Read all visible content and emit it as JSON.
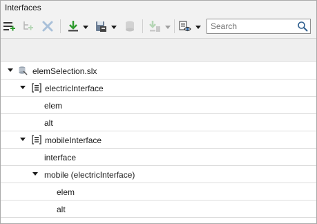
{
  "panel": {
    "title": "Interfaces"
  },
  "toolbar": {
    "buttons": [
      {
        "icon": "add-interface-icon"
      },
      {
        "icon": "add-element-icon"
      },
      {
        "icon": "delete-icon"
      },
      {
        "icon": "import-icon"
      },
      {
        "icon": "save-dictionary-icon"
      },
      {
        "icon": "database-icon"
      },
      {
        "icon": "apply-interface-icon"
      },
      {
        "icon": "view-options-icon"
      }
    ],
    "search_placeholder": "Search"
  },
  "tree": [
    {
      "label": "elemSelection.slx",
      "icon": "model-file-icon",
      "expanded": true
    },
    {
      "label": "electricInterface",
      "icon": "interface-icon",
      "expanded": true
    },
    {
      "label": "elem"
    },
    {
      "label": "alt"
    },
    {
      "label": "mobileInterface",
      "icon": "interface-icon",
      "expanded": true
    },
    {
      "label": "interface"
    },
    {
      "label": "mobile (electricInterface)",
      "expanded": true
    },
    {
      "label": "elem"
    },
    {
      "label": "alt"
    }
  ]
}
